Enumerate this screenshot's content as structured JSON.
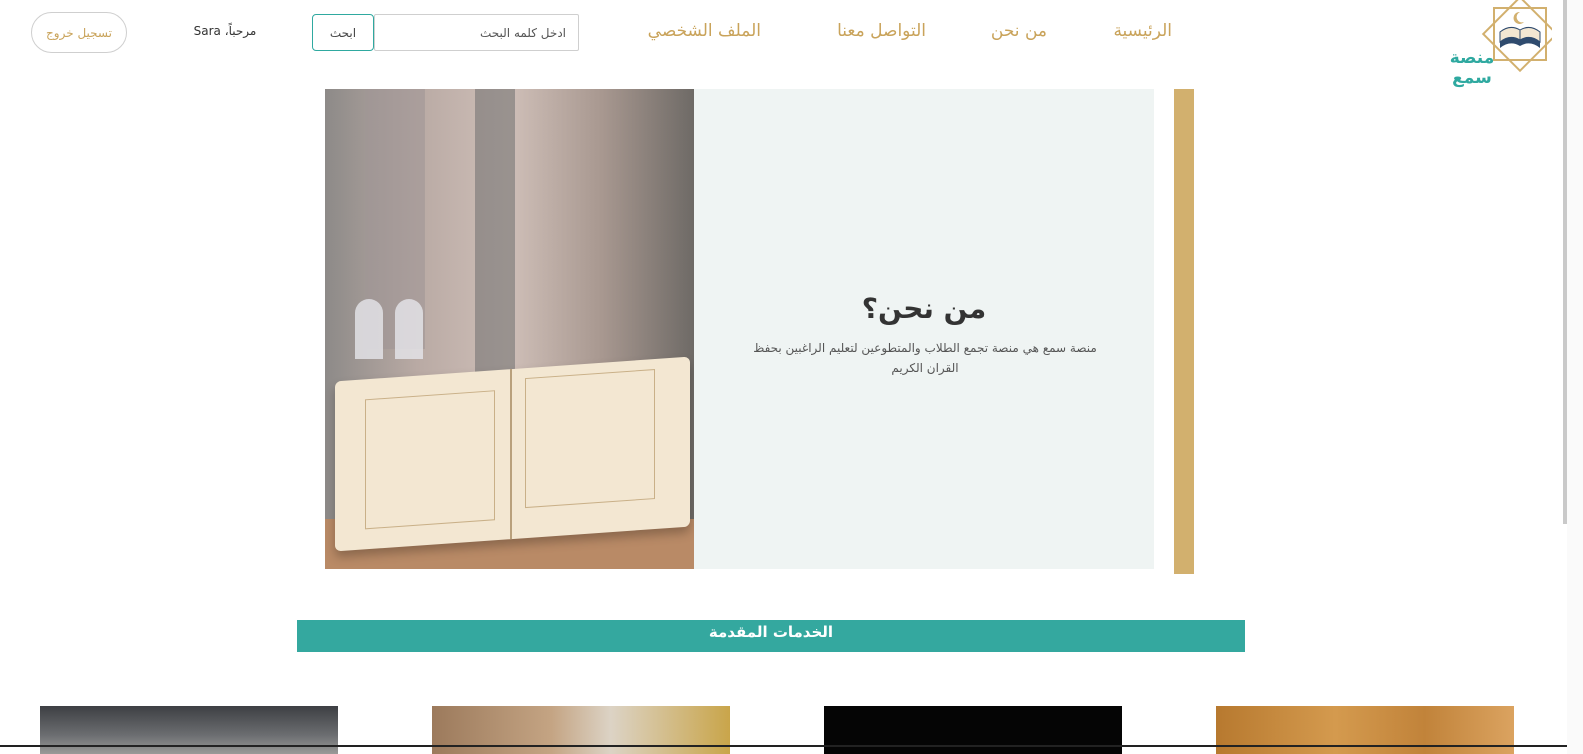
{
  "logo": {
    "text": "منصة سمع",
    "icon": "book-star-icon"
  },
  "nav": {
    "items": [
      {
        "label": "الرئيسية"
      },
      {
        "label": "من نحن"
      },
      {
        "label": "التواصل معنا"
      },
      {
        "label": "الملف الشخصي"
      }
    ]
  },
  "search": {
    "placeholder": "ادخل كلمه البحث",
    "value": "",
    "button_label": "ابحث"
  },
  "user": {
    "greeting": "مرحباً، Sara"
  },
  "logout": {
    "label": "تسجيل خروج"
  },
  "about": {
    "title": "من نحن؟",
    "text": "منصة سمع هي منصة تجمع الطلاب والمتطوعين لتعليم الراغبين بحفظ القران الكريم"
  },
  "services": {
    "title": "الخدمات المقدمة"
  },
  "colors": {
    "gold": "#c9a35a",
    "teal": "#34a89f",
    "panel": "#eff4f3"
  }
}
